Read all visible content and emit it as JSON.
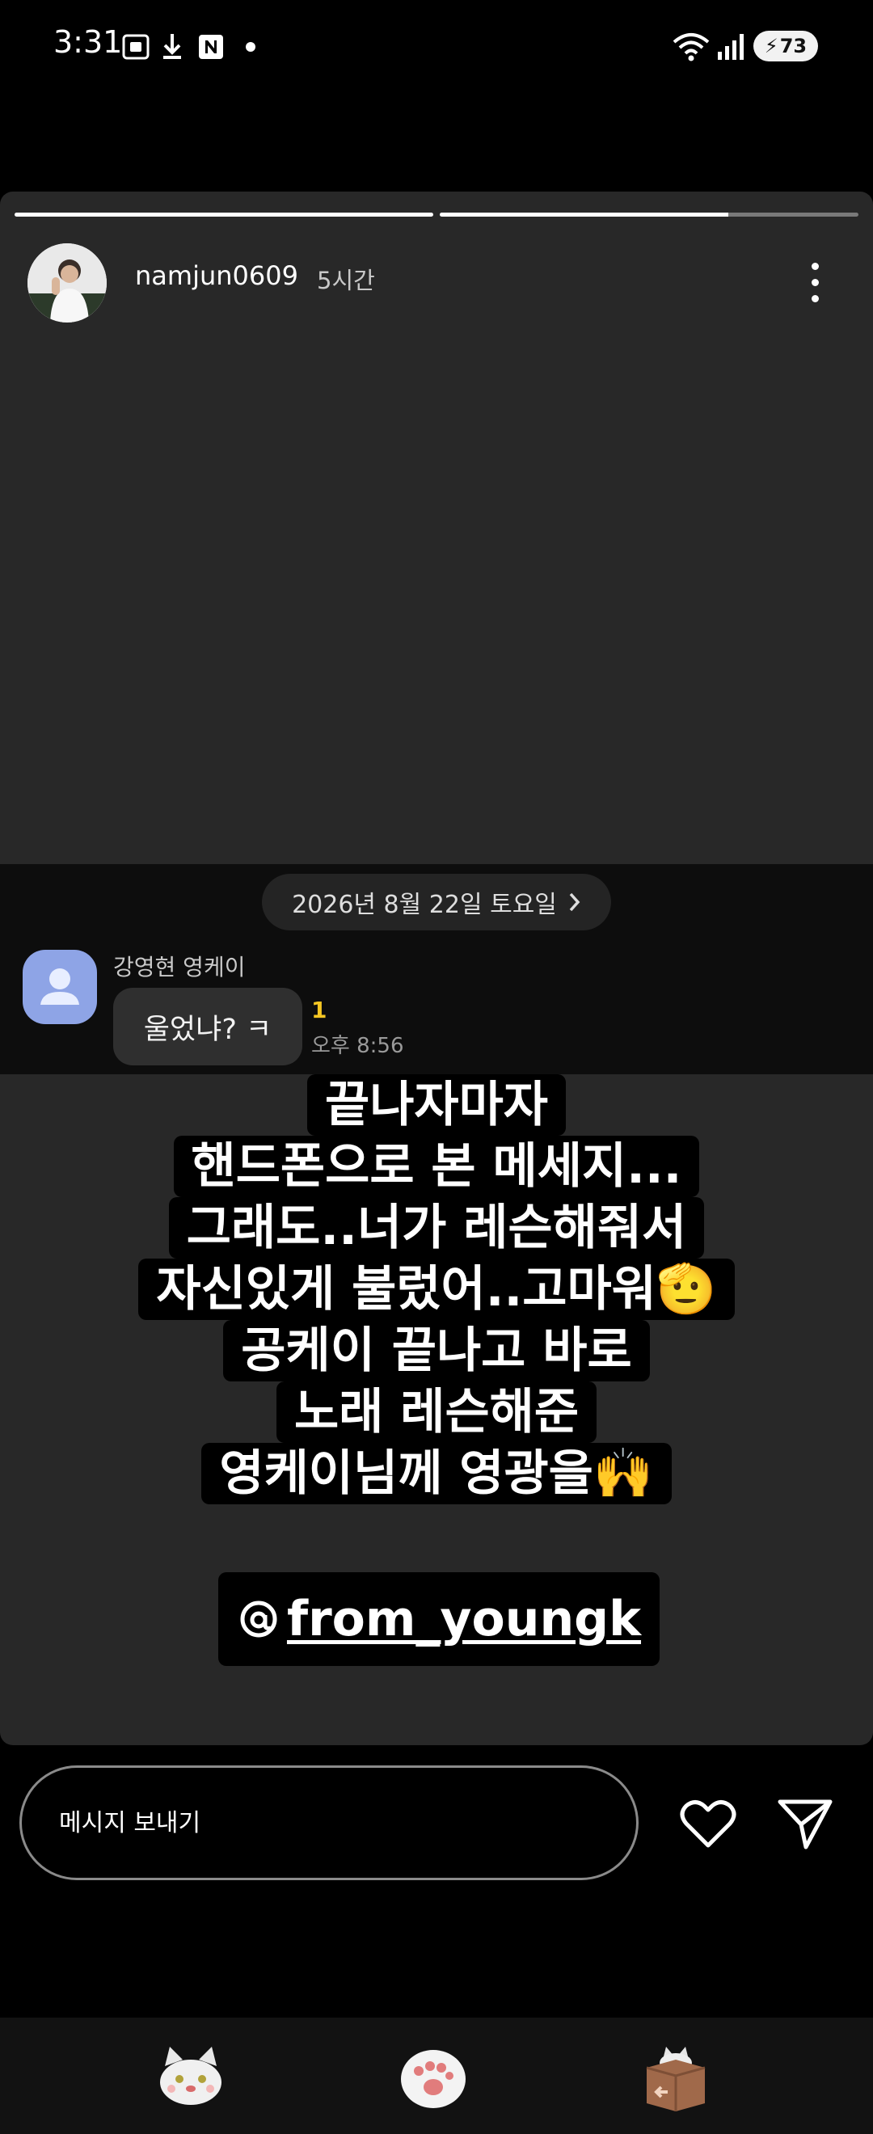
{
  "status_bar": {
    "time": "3:31",
    "battery_level": "73",
    "icons": [
      "screenshot-icon",
      "download-icon",
      "naver-icon",
      "dot-icon",
      "wifi-icon",
      "signal-icon",
      "battery-icon"
    ]
  },
  "story": {
    "progress": [
      1.0,
      0.69
    ],
    "username": "namjun0609",
    "time_ago": "5시간",
    "chat_screenshot": {
      "date": "2026년 8월 22일 토요일",
      "sender": "강영현 영케이",
      "message": "울었냐? ㅋ",
      "unread_count": "1",
      "time": "오후 8:56"
    },
    "caption_lines": [
      "끝나자마자",
      "핸드폰으로 본 메세지...",
      "그래도..너가 레슨해줘서",
      "자신있게 불렀어..고마워🫡",
      "공케이 끝나고 바로",
      "노래 레슨해준",
      "영케이님께 영광을🙌"
    ],
    "mention": "from_youngk"
  },
  "reply_bar": {
    "placeholder": "메시지 보내기"
  },
  "bottom_nav": {
    "items": [
      "cat-character-icon",
      "paw-icon",
      "box-cat-icon"
    ]
  },
  "colors": {
    "story_bg": "#282828",
    "chat_bg": "#0d0d0d",
    "unread": "#f5c623",
    "chat_avatar": "#8ea4e6"
  }
}
